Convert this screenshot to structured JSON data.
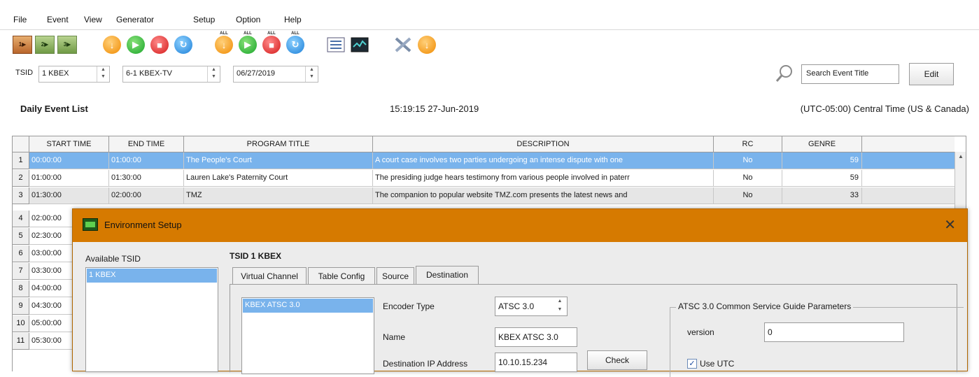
{
  "menu": [
    "File",
    "Event",
    "View",
    "Generator",
    "Setup",
    "Option",
    "Help"
  ],
  "toolbar": {
    "tsid_icons": [
      "1▶",
      "2▶",
      "3▶"
    ],
    "all_tag": "ALL"
  },
  "selectors": {
    "tsid_label": "TSID",
    "tsid_value": "1 KBEX",
    "channel_value": "6-1 KBEX-TV",
    "date_value": "06/27/2019"
  },
  "search": {
    "value": "Search Event Title"
  },
  "edit_label": "Edit",
  "info": {
    "list_title": "Daily Event List",
    "clock": "15:19:15  27-Jun-2019",
    "timezone": "(UTC-05:00) Central Time (US & Canada)"
  },
  "table": {
    "columns": [
      "START TIME",
      "END TIME",
      "PROGRAM TITLE",
      "DESCRIPTION",
      "RC",
      "GENRE"
    ],
    "rows": [
      {
        "n": "1",
        "start": "00:00:00",
        "end": "01:00:00",
        "title": "The People's Court",
        "desc": "A court case involves two parties undergoing an intense dispute with one",
        "rc": "No",
        "genre": "59"
      },
      {
        "n": "2",
        "start": "01:00:00",
        "end": "01:30:00",
        "title": "Lauren Lake's Paternity Court",
        "desc": "The presiding judge hears testimony from various people involved in paterr",
        "rc": "No",
        "genre": "59"
      },
      {
        "n": "3",
        "start": "01:30:00",
        "end": "02:00:00",
        "title": "TMZ",
        "desc": "The companion to popular website TMZ.com presents the latest news and",
        "rc": "No",
        "genre": "33"
      },
      {
        "n": "4",
        "start": "02:00:00"
      },
      {
        "n": "5",
        "start": "02:30:00"
      },
      {
        "n": "6",
        "start": "03:00:00"
      },
      {
        "n": "7",
        "start": "03:30:00"
      },
      {
        "n": "8",
        "start": "04:00:00"
      },
      {
        "n": "9",
        "start": "04:30:00"
      },
      {
        "n": "10",
        "start": "05:00:00"
      },
      {
        "n": "11",
        "start": "05:30:00"
      }
    ]
  },
  "dialog": {
    "title": "Environment Setup",
    "close": "✕",
    "available_label": "Available TSID",
    "available_items": [
      "1 KBEX"
    ],
    "tsid_header": "TSID  1 KBEX",
    "tabs": [
      "Virtual Channel",
      "Table Config",
      "Source",
      "Destination"
    ],
    "active_tab": "Destination",
    "destinations": [
      "KBEX ATSC 3.0"
    ],
    "fields": {
      "encoder_type_label": "Encoder Type",
      "encoder_type_value": "ATSC 3.0",
      "name_label": "Name",
      "name_value": "KBEX ATSC 3.0",
      "dest_ip_label": "Destination IP Address",
      "dest_ip_value": "10.10.15.234",
      "check_label": "Check"
    },
    "csg": {
      "title": "ATSC 3.0 Common Service Guide Parameters",
      "version_label": "version",
      "version_value": "0",
      "use_utc_label": "Use UTC",
      "use_utc_checked": true
    }
  },
  "colors": {
    "selection": "#79b3ec",
    "dialog_title_bar": "#d67a00",
    "dialog_bg": "#ececec"
  }
}
